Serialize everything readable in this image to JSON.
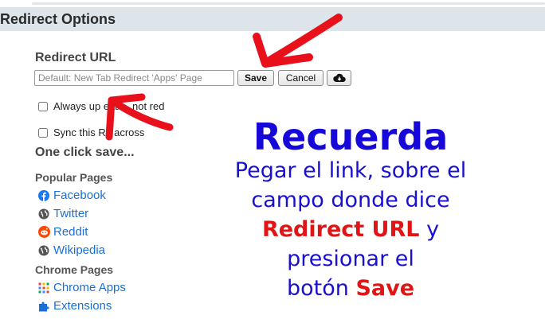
{
  "header": {
    "title": "Redirect Options"
  },
  "redirect": {
    "section_title": "Redirect URL",
    "url_value": "",
    "url_placeholder": "Default: New Tab Redirect 'Apps' Page",
    "save_label": "Save",
    "cancel_label": "Cancel",
    "cloud_icon": "cloud-download-icon"
  },
  "options": [
    {
      "label": "Always update tab, not redirect",
      "visible_label": "Always up      e tab, not red",
      "checked": false
    },
    {
      "label": "Sync this URL across devices",
      "visible_label": "Sync this    RL across",
      "checked": false
    }
  ],
  "one_click": {
    "title": "One click save...",
    "popular_title": "Popular Pages",
    "popular": [
      {
        "label": "Facebook",
        "icon": "facebook-icon",
        "color": "#1877f2"
      },
      {
        "label": "Twitter",
        "icon": "globe-icon",
        "color": "#555555"
      },
      {
        "label": "Reddit",
        "icon": "reddit-icon",
        "color": "#ff4500"
      },
      {
        "label": "Wikipedia",
        "icon": "globe-icon",
        "color": "#555555"
      }
    ],
    "chrome_title": "Chrome Pages",
    "chrome": [
      {
        "label": "Chrome Apps",
        "icon": "apps-grid-icon"
      },
      {
        "label": "Extensions",
        "icon": "puzzle-icon",
        "color": "#1a6fd6"
      }
    ]
  },
  "annotation": {
    "title": "Recuerda",
    "line1": "Pegar el link, sobre el",
    "line2": "campo donde dice",
    "line3_red": "Redirect URL",
    "line3_rest": " y",
    "line4": "presionar el",
    "line5_start": "botón ",
    "line5_red": "Save",
    "text_color": "#1508d8",
    "highlight_color": "#e01515",
    "arrow_color": "#e8101a"
  }
}
